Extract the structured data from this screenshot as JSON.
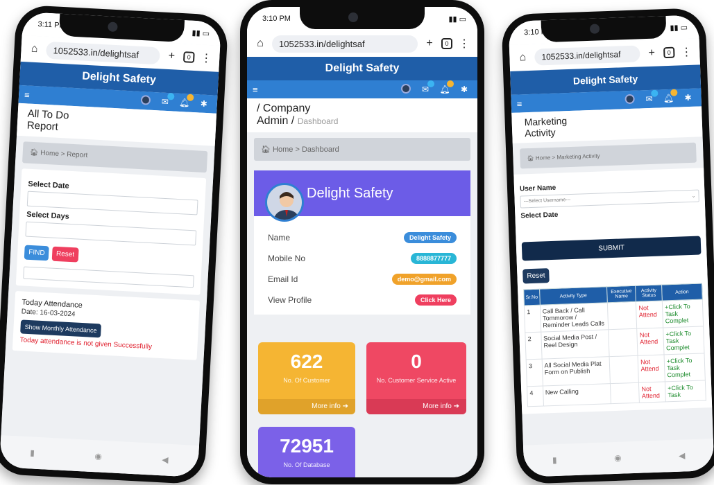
{
  "phone1": {
    "status_time": "3:11 PM",
    "url": "1052533.in/delightsaf",
    "brand": "Delight Safety",
    "page_title_1": "All To Do",
    "page_title_2": "Report",
    "crumb_home": "Home",
    "crumb_sep": ">",
    "crumb_current": "Report",
    "select_date_label": "Select Date",
    "select_days_label": "Select Days",
    "find_button": "FIND",
    "reset_button": "Reset",
    "attendance_title": "Today Attendance",
    "attendance_date": "Date: 16-03-2024",
    "monthly_button": "Show Monthly Attendance",
    "attendance_message": "Today attendance is not given Successfully"
  },
  "phone2": {
    "status_time": "3:10 PM",
    "url": "1052533.in/delightsaf",
    "brand": "Delight Safety",
    "page_title_1": "/ Company",
    "page_title_2": "Admin /",
    "page_title_sub": "Dashboard",
    "crumb_home": "Home",
    "crumb_sep": ">",
    "crumb_current": "Dashboard",
    "profile_name": "Delight Safety",
    "rows": [
      {
        "label": "Name",
        "value": "Delight Safety",
        "color": "#3b8ddb"
      },
      {
        "label": "Mobile No",
        "value": "8888877777",
        "color": "#29b6d6"
      },
      {
        "label": "Email Id",
        "value": "demo@gmail.com",
        "color": "#f0a22a"
      },
      {
        "label": "View Profile",
        "value": "Click Here",
        "color": "#ef3f5f"
      }
    ],
    "stats": [
      {
        "number": "622",
        "caption": "No. Of Customer",
        "more": "More info ➔",
        "color": "#f5b533"
      },
      {
        "number": "0",
        "caption": "No. Customer Service Active",
        "more": "More info ➔",
        "color": "#ef4863"
      },
      {
        "number": "72951",
        "caption": "No. Of Database",
        "color": "#7b61e8"
      }
    ]
  },
  "phone3": {
    "status_time": "3:10 PM",
    "url": "1052533.in/delightsaf",
    "brand": "Delight Safety",
    "page_title_1": "Marketing",
    "page_title_2": "Activity",
    "crumb_home": "Home",
    "crumb_sep": ">",
    "crumb_current": "Marketing Activity",
    "user_name_label": "User Name",
    "user_name_placeholder": "---Select Username---",
    "select_date_label": "Select Date",
    "submit_button": "SUBMIT",
    "reset_button": "Reset",
    "table_headers": [
      "Sr.No",
      "Activity Type",
      "Executive Name",
      "Activity Status",
      "Action"
    ],
    "table_rows": [
      {
        "sr": "1",
        "type": "Call Back / Call Tommorow / Reminder Leads Calls",
        "status": "Not Attend",
        "action": "+Click To Task Complet"
      },
      {
        "sr": "2",
        "type": "Social Media Post / Reel Design",
        "status": "Not Attend",
        "action": "+Click To Task Complet"
      },
      {
        "sr": "3",
        "type": "All Social Media Plat Form on Publish",
        "status": "Not Attend",
        "action": "+Click To Task Complet"
      },
      {
        "sr": "4",
        "type": "New Calling",
        "status": "Not Attend",
        "action": "+Click To Task"
      }
    ]
  }
}
